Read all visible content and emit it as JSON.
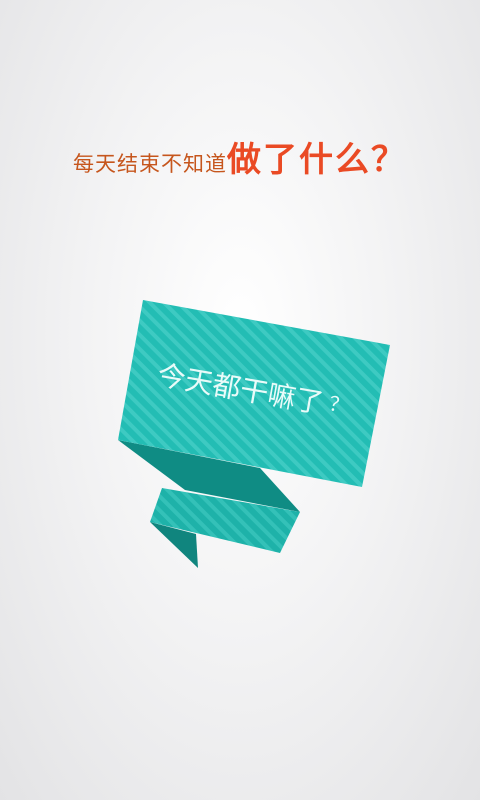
{
  "headline": {
    "prefix": "每天结束不知道",
    "emphasis": "做了什么？"
  },
  "banner": {
    "text": "今天都干嘛了",
    "question": "？"
  },
  "colors": {
    "prefix_text": "#c6561d",
    "emphasis_text": "#ea4a24",
    "banner_face": "#23bdb4",
    "banner_stripe": "#41cbc3",
    "banner_fold_dark": "#0e8a82"
  }
}
